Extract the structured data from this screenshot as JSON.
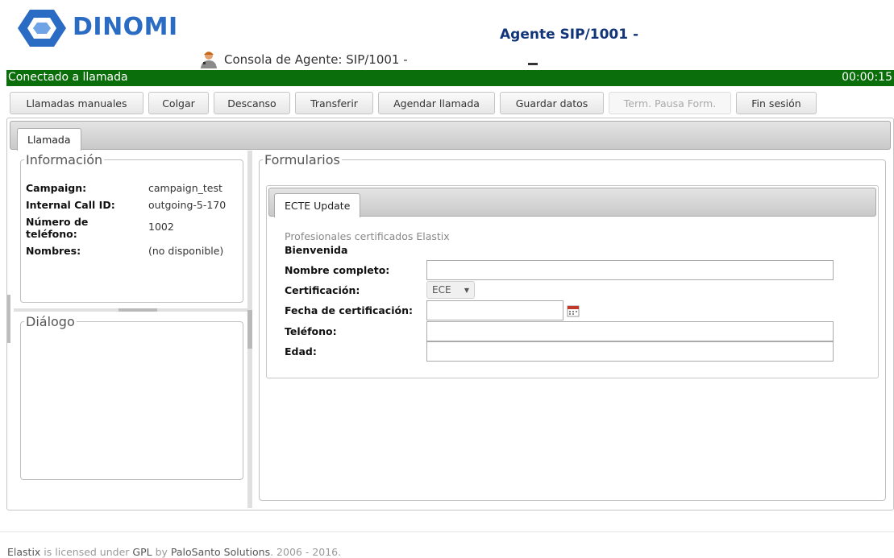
{
  "header": {
    "logo_text": "DINOMI",
    "agent_title": "Agente SIP/1001 -",
    "console_title": "Consola de Agente: SIP/1001 -"
  },
  "status": {
    "text": "Conectado a llamada",
    "timer": "00:00:15",
    "color": "#0a6e0a"
  },
  "toolbar": {
    "buttons": [
      {
        "label": "Llamadas manuales"
      },
      {
        "label": "Colgar"
      },
      {
        "label": "Descanso"
      },
      {
        "label": "Transferir"
      },
      {
        "label": "Agendar llamada"
      },
      {
        "label": "Guardar datos"
      },
      {
        "label": "Term. Pausa Form."
      },
      {
        "label": "Fin sesión"
      }
    ]
  },
  "main": {
    "tab_label": "Llamada"
  },
  "info": {
    "legend": "Información",
    "rows": [
      {
        "label": "Campaign:",
        "value": "campaign_test"
      },
      {
        "label": "Internal Call ID:",
        "value": "outgoing-5-170"
      },
      {
        "label": "Número de teléfono:",
        "value": "1002"
      },
      {
        "label": "Nombres:",
        "value": "(no disponible)"
      }
    ]
  },
  "dialog": {
    "legend": "Diálogo"
  },
  "forms": {
    "legend": "Formularios",
    "tab_label": "ECTE Update",
    "description": "Profesionales certificados Elastix",
    "welcome": "Bienvenida",
    "fields": {
      "nombre": {
        "label": "Nombre completo:",
        "value": ""
      },
      "certificacion": {
        "label": "Certificación:",
        "value": "ECE"
      },
      "fecha": {
        "label": "Fecha de certificación:",
        "value": ""
      },
      "telefono": {
        "label": "Teléfono:",
        "value": ""
      },
      "edad": {
        "label": "Edad:",
        "value": ""
      }
    }
  },
  "footer": {
    "product": "Elastix",
    "text1": " is licensed under ",
    "license": "GPL",
    "text2": " by ",
    "company": "PaloSanto Solutions",
    "text3": ". 2006 - 2016."
  }
}
